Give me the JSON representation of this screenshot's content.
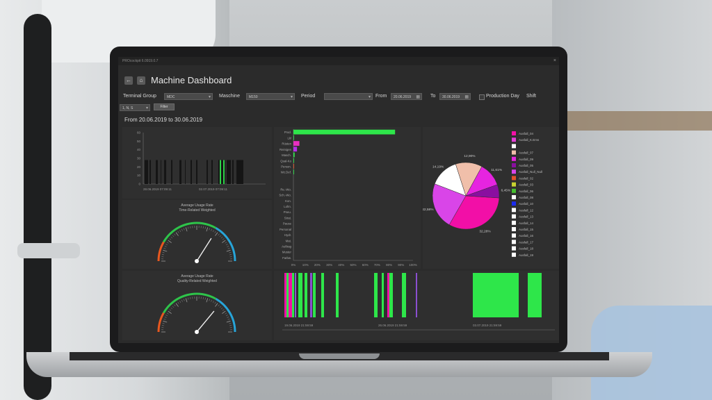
{
  "window": {
    "title": "PROcockpit 6.0919.0.7",
    "close": "×"
  },
  "nav": {
    "back": "←",
    "home": "⌂"
  },
  "page_title": "Machine Dashboard",
  "filters": {
    "terminal_group_label": "Terminal Group",
    "terminal_group_value": "MDC",
    "machine_label": "Maschine",
    "machine_value": "M150",
    "period_label": "Period",
    "period_value": "",
    "from_label": "From",
    "from_value": "20.06.2019",
    "to_label": "To",
    "to_value": "30.06.2019",
    "production_day_label": "Production Day",
    "shift_label": "Shift",
    "shift_value": "1, N, S",
    "filter_button": "Filter"
  },
  "date_range_text": "From 20.06.2019 to 30.06.2019",
  "gauges": [
    {
      "title_line1": "Average Usage Rate",
      "title_line2": "Time-Related Weighted",
      "value": 0.68
    },
    {
      "title_line1": "Average Usage Rate",
      "title_line2": "Quality-Related Weighted",
      "value": 0.72
    }
  ],
  "chart_data": [
    {
      "type": "bar",
      "yticks": [
        "60",
        "50",
        "40",
        "30",
        "20",
        "10",
        "0"
      ],
      "xticks": [
        "28.06.2019 07:09:11",
        "02.07.2019 07:09:11"
      ],
      "colors": {
        "bars": "#151515",
        "accent": "#2fd24a"
      }
    },
    {
      "type": "bar",
      "orientation": "horizontal",
      "categories": [
        "Prod.",
        "Lkl",
        "Rüsten",
        "Reinigen",
        "Masch.",
        "Qual-Ko",
        "Person.",
        "Wz.Def.",
        "",
        "",
        "Re.-Wo.",
        "Sch.-Wo.",
        "Kon.",
        "Lohn.",
        "Pneu.",
        "Strat.",
        "Pause",
        "Personal",
        "Hydr.",
        "Mat.",
        "Auftrag",
        "Muster",
        "Farbw."
      ],
      "values": [
        85,
        0.5,
        5,
        3,
        1,
        0.5,
        0.5,
        0.5,
        0,
        0,
        0,
        0,
        0,
        0,
        0,
        0,
        0,
        0,
        0,
        0,
        0,
        0,
        0
      ],
      "colors": [
        "#2ee64a",
        "#2ee64a",
        "#e82fc0",
        "#b52fe8",
        "#2ee64a",
        "#2ee64a",
        "#e85a2f",
        "#2ee64a",
        "#2ee64a",
        "#2ee64a",
        "#2ee64a",
        "#2ee64a",
        "#2ee64a",
        "#2ee64a",
        "#2ee64a",
        "#2ee64a",
        "#2ee64a",
        "#2ee64a",
        "#2ee64a",
        "#2ee64a",
        "#2ee64a",
        "#2ee64a",
        "#2ee64a"
      ],
      "xticks": [
        "0%",
        "10%",
        "20%",
        "30%",
        "40%",
        "50%",
        "60%",
        "70%",
        "80%",
        "90%",
        "100%"
      ],
      "xlim": [
        0,
        100
      ]
    },
    {
      "type": "pie",
      "slices": [
        {
          "label": "32,28%",
          "value": 32.28,
          "color": "#f20fa7"
        },
        {
          "label": "22,58%",
          "value": 22.58,
          "color": "#d945e8"
        },
        {
          "label": "14,19%",
          "value": 14.19,
          "color": "#ffffff"
        },
        {
          "label": "12,90%",
          "value": 12.9,
          "color": "#f0bfaa"
        },
        {
          "label": "11,61%",
          "value": 11.61,
          "color": "#e624e0"
        },
        {
          "label": "6,45%",
          "value": 6.45,
          "color": "#8a0fa0"
        }
      ],
      "legend": [
        {
          "label": "Ausfall_04",
          "color": "#f20fa7"
        },
        {
          "label": "Ausfall_K.Ems",
          "color": "#e23fd6"
        },
        {
          "label": "",
          "color": "#ffffff"
        },
        {
          "label": "Ausfall_07",
          "color": "#f0bfaa"
        },
        {
          "label": "Ausfall_09",
          "color": "#e624e0"
        },
        {
          "label": "Ausfall_05",
          "color": "#8a0fa0"
        },
        {
          "label": "Ausfall_Null_Null",
          "color": "#d945e8"
        },
        {
          "label": "Ausfall_02",
          "color": "#e4502a"
        },
        {
          "label": "Ausfall_03",
          "color": "#c7d230"
        },
        {
          "label": "Ausfall_06",
          "color": "#46c02f"
        },
        {
          "label": "Ausfall_08",
          "color": "#ffffff"
        },
        {
          "label": "Ausfall_10",
          "color": "#1b2cf0"
        },
        {
          "label": "Ausfall_12",
          "color": "#ffffff"
        },
        {
          "label": "Ausfall_13",
          "color": "#ffffff"
        },
        {
          "label": "Ausfall_14",
          "color": "#ffffff"
        },
        {
          "label": "Ausfall_15",
          "color": "#ffffff"
        },
        {
          "label": "Ausfall_16",
          "color": "#ffffff"
        },
        {
          "label": "Ausfall_17",
          "color": "#ffffff"
        },
        {
          "label": "Ausfall_18",
          "color": "#ffffff"
        },
        {
          "label": "Ausfall_19",
          "color": "#ffffff"
        }
      ]
    },
    {
      "type": "bar",
      "xticks": [
        "19.06.2019 21:59:59",
        "26.06.2019 21:59:59",
        "03.07.2019 21:59:59"
      ],
      "colors": {
        "primary": "#2ee64a",
        "secondary": "#f20fa7",
        "other": "#8a4fd0"
      }
    }
  ]
}
